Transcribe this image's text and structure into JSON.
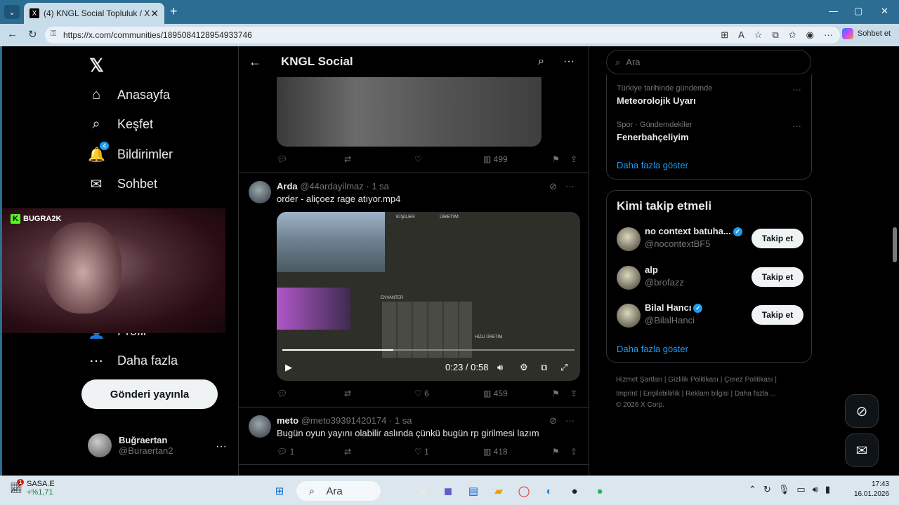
{
  "browser": {
    "tab_title": "(4) KNGL Social Topluluk / X",
    "tab_close": "✕",
    "new_tab": "+",
    "url": "https://x.com/communities/1895084128954933746",
    "copilot_label": "Sohbet et",
    "win_min": "—",
    "win_max": "▢",
    "win_close": "✕"
  },
  "sidebar": {
    "logo": "𝕏",
    "items": [
      {
        "label": "Anasayfa",
        "icon": "⌂"
      },
      {
        "label": "Keşfet",
        "icon": "⌕"
      },
      {
        "label": "Bildirimler",
        "icon": "🔔",
        "badge": "4"
      },
      {
        "label": "Sohbet",
        "icon": "✉"
      },
      {
        "label": "Profil",
        "icon": "👤"
      },
      {
        "label": "Daha fazla",
        "icon": "⋯"
      }
    ],
    "post_button": "Gönderi yayınla",
    "user": {
      "name": "Buğraertan",
      "handle": "@Buraertan2",
      "more": "···"
    }
  },
  "webcam": {
    "brand": "BUGRA2K"
  },
  "main": {
    "title": "KNGL Social",
    "back": "←",
    "top_post_actions": {
      "views": "499"
    },
    "tweets": [
      {
        "name": "Arda",
        "handle": "@44ardayilmaz",
        "time": "· 1 sa",
        "text": "order - aliçoez rage atıyor.mp4",
        "replies": "",
        "likes": "6",
        "views": "459",
        "video": {
          "time": "0:23 / 0:58",
          "progress": 0.38,
          "labels": [
            "KİŞİLER",
            "ÜRETİM",
            "ENVANTER",
            "HIZLI ÜRETİM"
          ]
        }
      },
      {
        "name": "meto",
        "handle": "@meto39391420174",
        "time": "· 1 sa",
        "text": "Bugün oyun yayını olabilir aslında  çünkü bugün rp girilmesi lazım",
        "replies": "1",
        "likes": "1",
        "views": "418"
      }
    ]
  },
  "right": {
    "search_placeholder": "Ara",
    "trends": [
      {
        "context": "Türkiye tarihinde gündemde",
        "name": "Meteorolojik Uyarı"
      },
      {
        "context": "Spor · Gündemdekiler",
        "name": "Fenerbahçeliyim"
      }
    ],
    "show_more": "Daha fazla göster",
    "who_to_follow": {
      "title": "Kimi takip etmeli",
      "users": [
        {
          "name": "no context batuha...",
          "handle": "@nocontextBF5",
          "verified": true,
          "button": "Takip et"
        },
        {
          "name": "alp",
          "handle": "@brofazz",
          "verified": false,
          "button": "Takip et"
        },
        {
          "name": "Bilal Hancı",
          "handle": "@BilalHanci",
          "verified": true,
          "button": "Takip et"
        }
      ],
      "show_more": "Daha fazla göster"
    },
    "footer": {
      "line1": "Hizmet Şartları  |  Gizlilik Politikası  |  Çerez Politikası  |",
      "line2": "Imprint  |  Erişilebilirlik  |  Reklam bilgisi  |  Daha fazla ...",
      "line3": "© 2026 X Corp."
    }
  },
  "taskbar": {
    "stock_name": "SASA.E",
    "stock_change": "+%1,71",
    "stock_badge": "1",
    "search": "Ara",
    "time": "17:43",
    "date": "16.01.2026"
  }
}
